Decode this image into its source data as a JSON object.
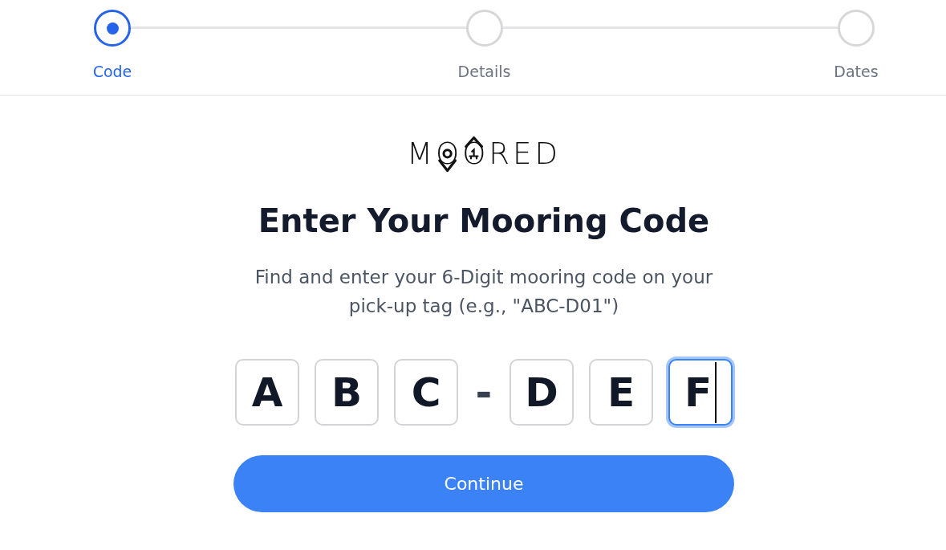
{
  "steps": [
    {
      "label": "Code",
      "selected": true
    },
    {
      "label": "Details",
      "selected": false
    },
    {
      "label": "Dates",
      "selected": false
    }
  ],
  "logo": {
    "text": "MOORED"
  },
  "heading": "Enter Your Mooring Code",
  "instructions": "Find and enter your 6-Digit mooring code on your pick-up tag (e.g., \"ABC-D01\")",
  "code": [
    {
      "kind": "field",
      "value": "A",
      "focused": false
    },
    {
      "kind": "field",
      "value": "B",
      "focused": false
    },
    {
      "kind": "field",
      "value": "C",
      "focused": false
    },
    {
      "kind": "separator",
      "text": "-"
    },
    {
      "kind": "field",
      "value": "D",
      "focused": false
    },
    {
      "kind": "field",
      "value": "E",
      "focused": false
    },
    {
      "kind": "field",
      "value": "F",
      "focused": true
    }
  ],
  "continue_button": {
    "label": "Continue"
  }
}
